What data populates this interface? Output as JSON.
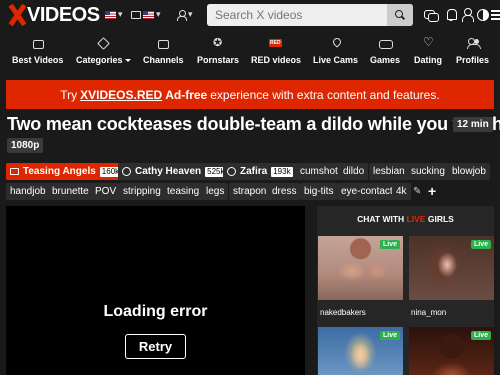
{
  "header": {
    "logo_text": "VIDEOS",
    "language_arrow": "▾",
    "country_arrow": "▾",
    "orientation_arrow": "▾",
    "search_placeholder": "Search X videos"
  },
  "nav": [
    {
      "label": "Best Videos",
      "icon": "video-box-icon"
    },
    {
      "label": "Categories",
      "icon": "tag-icon",
      "has_caret": true
    },
    {
      "label": "Channels",
      "icon": "channel-icon"
    },
    {
      "label": "Pornstars",
      "icon": "star-icon"
    },
    {
      "label": "RED videos",
      "icon": "red-badge-icon"
    },
    {
      "label": "Live Cams",
      "icon": "live-pin-icon"
    },
    {
      "label": "Games",
      "icon": "gamepad-icon"
    },
    {
      "label": "Dating",
      "icon": "heart-icon"
    },
    {
      "label": "Profiles",
      "icon": "users-icon"
    }
  ],
  "promo": {
    "prefix": "Try",
    "brand": "XVIDEOS.RED",
    "highlight": "Ad-free",
    "suffix": "experience with extra content and features."
  },
  "video": {
    "title": "Two mean cockteases double-team a dildo while you watch",
    "duration": "12 min",
    "quality": "1080p"
  },
  "main_tag": {
    "name": "Teasing Angels",
    "count": "160k"
  },
  "models": [
    {
      "name": "Cathy Heaven",
      "count": "525k"
    },
    {
      "name": "Zafira",
      "count": "193k"
    }
  ],
  "tags": [
    "cumshot",
    "dildo",
    "lesbian",
    "sucking",
    "blowjob",
    "handjob",
    "brunette",
    "POV",
    "stripping",
    "teasing",
    "legs",
    "strapon",
    "dress",
    "big-tits",
    "eye-contact",
    "4k"
  ],
  "player": {
    "error_text": "Loading error",
    "retry_label": "Retry"
  },
  "chat": {
    "heading_prefix": "CHAT WITH",
    "heading_live": "LIVE",
    "heading_suffix": "GIRLS",
    "live_badge": "Live",
    "cams": [
      {
        "name": "nakedbakers"
      },
      {
        "name": "nina_mon"
      },
      {
        "name": ""
      },
      {
        "name": ""
      }
    ]
  },
  "colors": {
    "brand_red": "#de2600",
    "live_green": "#2bb14d",
    "background": "#1a1a1a"
  }
}
